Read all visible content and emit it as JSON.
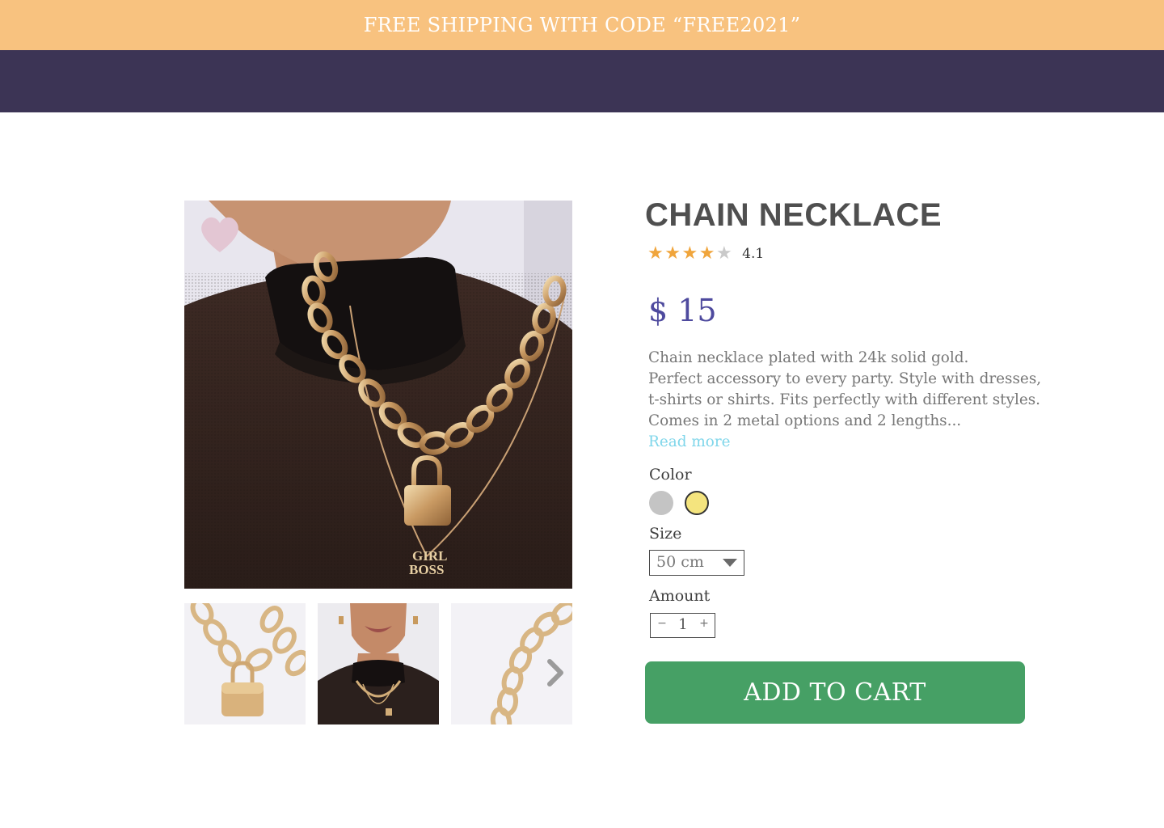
{
  "promo": {
    "text": "FREE SHIPPING WITH CODE “FREE2021”"
  },
  "product": {
    "title": "CHAIN NECKLACE",
    "rating": {
      "value": "4.1",
      "stars_filled": 4,
      "stars_total": 5
    },
    "price": "$ 15",
    "description": [
      "Chain necklace plated with 24k solid gold.",
      "Perfect accessory to every party. Style with dresses,",
      "t-shirts or shirts. Fits perfectly with different styles.",
      "Comes in 2 metal options and 2 lengths..."
    ],
    "read_more": "Read more",
    "pendant_text": [
      "GIRL",
      "BOSS"
    ]
  },
  "options": {
    "color": {
      "label": "Color",
      "swatches": [
        {
          "name": "silver",
          "hex": "#c4c4c4",
          "selected": false
        },
        {
          "name": "gold",
          "hex": "#f4e47e",
          "selected": true
        }
      ]
    },
    "size": {
      "label": "Size",
      "selected": "50 cm"
    },
    "amount": {
      "label": "Amount",
      "value": "1",
      "minus": "−",
      "plus": "+"
    }
  },
  "cart": {
    "add_label": "ADD TO CART"
  },
  "gallery": {
    "favorite_icon": "heart-icon",
    "next_icon": "chevron-right-icon",
    "thumbnail_count": 3
  },
  "colors": {
    "promo_bg": "#f8c27f",
    "nav_bg": "#3c3455",
    "price": "#4e4a9e",
    "link": "#7fd6ea",
    "cart_button": "#46a065",
    "star_on": "#f0a53c",
    "star_off": "#c9c9c9"
  }
}
